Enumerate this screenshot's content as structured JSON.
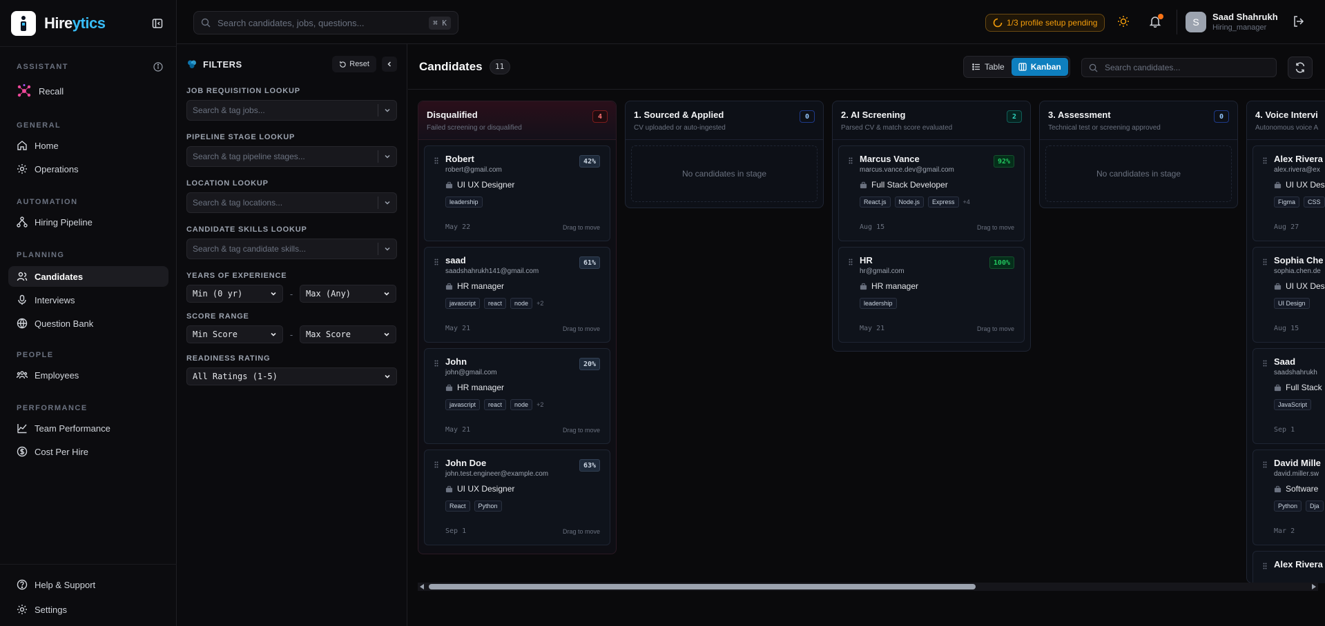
{
  "brand": {
    "name_a": "Hire",
    "name_b": "ytics"
  },
  "sidebar": {
    "sections": [
      {
        "label": "ASSISTANT",
        "items": [
          {
            "label": "Recall",
            "icon": "recall-molecule-icon"
          }
        ]
      },
      {
        "label": "GENERAL",
        "items": [
          {
            "label": "Home",
            "icon": "home-icon"
          },
          {
            "label": "Operations",
            "icon": "gear-icon"
          }
        ]
      },
      {
        "label": "AUTOMATION",
        "items": [
          {
            "label": "Hiring Pipeline",
            "icon": "pipeline-icon"
          }
        ]
      },
      {
        "label": "PLANNING",
        "items": [
          {
            "label": "Candidates",
            "icon": "users-icon"
          },
          {
            "label": "Interviews",
            "icon": "mic-icon"
          },
          {
            "label": "Question Bank",
            "icon": "globe-icon"
          }
        ]
      },
      {
        "label": "PEOPLE",
        "items": [
          {
            "label": "Employees",
            "icon": "team-icon"
          }
        ]
      },
      {
        "label": "PERFORMANCE",
        "items": [
          {
            "label": "Team Performance",
            "icon": "chart-line-icon"
          },
          {
            "label": "Cost Per Hire",
            "icon": "dollar-icon"
          }
        ]
      }
    ],
    "footer": [
      {
        "label": "Help & Support",
        "icon": "help-icon"
      },
      {
        "label": "Settings",
        "icon": "gear-icon"
      }
    ]
  },
  "topbar": {
    "search_placeholder": "Search candidates, jobs, questions...",
    "shortcut": "⌘ K",
    "setup_pill": "1/3 profile setup pending",
    "user_initial": "S",
    "user_name": "Saad Shahrukh",
    "user_role": "Hiring_manager"
  },
  "filters": {
    "title": "FILTERS",
    "reset": "Reset",
    "job_label": "JOB REQUISITION LOOKUP",
    "job_placeholder": "Search & tag jobs...",
    "stage_label": "PIPELINE STAGE LOOKUP",
    "stage_placeholder": "Search & tag pipeline stages...",
    "location_label": "LOCATION LOOKUP",
    "location_placeholder": "Search & tag locations...",
    "skills_label": "CANDIDATE SKILLS LOOKUP",
    "skills_placeholder": "Search & tag candidate skills...",
    "experience_label": "YEARS OF EXPERIENCE",
    "experience_min": "Min (0 yr)",
    "experience_max": "Max (Any)",
    "score_label": "SCORE RANGE",
    "score_min": "Min Score",
    "score_max": "Max Score",
    "readiness_label": "READINESS RATING",
    "readiness_value": "All Ratings (1-5)",
    "range_sep": "-"
  },
  "main": {
    "title": "Candidates",
    "count": "11",
    "view_table": "Table",
    "view_kanban": "Kanban",
    "search_placeholder": "Search candidates..."
  },
  "board": {
    "drag_hint": "Drag to move",
    "empty_text": "No candidates in stage",
    "columns": [
      {
        "title": "Disqualified",
        "subtitle": "Failed screening or disqualified",
        "count": "4",
        "cards": [
          {
            "name": "Robert",
            "email": "robert@gmail.com",
            "role": "UI UX Designer",
            "tags": [
              "leadership"
            ],
            "more": "",
            "date": "May 22",
            "score": "42%"
          },
          {
            "name": "saad",
            "email": "saadshahrukh141@gmail.com",
            "role": "HR manager",
            "tags": [
              "javascript",
              "react",
              "node"
            ],
            "more": "+2",
            "date": "May 21",
            "score": "61%"
          },
          {
            "name": "John",
            "email": "john@gmail.com",
            "role": "HR manager",
            "tags": [
              "javascript",
              "react",
              "node"
            ],
            "more": "+2",
            "date": "May 21",
            "score": "20%"
          },
          {
            "name": "John Doe",
            "email": "john.test.engineer@example.com",
            "role": "UI UX Designer",
            "tags": [
              "React",
              "Python"
            ],
            "more": "",
            "date": "Sep 1",
            "score": "63%"
          }
        ]
      },
      {
        "title": "1. Sourced & Applied",
        "subtitle": "CV uploaded or auto-ingested",
        "count": "0",
        "cards": []
      },
      {
        "title": "2. AI Screening",
        "subtitle": "Parsed CV & match score evaluated",
        "count": "2",
        "cards": [
          {
            "name": "Marcus Vance",
            "email": "marcus.vance.dev@gmail.com",
            "role": "Full Stack Developer",
            "tags": [
              "React.js",
              "Node.js",
              "Express"
            ],
            "more": "+4",
            "date": "Aug 15",
            "score": "92%"
          },
          {
            "name": "HR",
            "email": "hr@gmail.com",
            "role": "HR manager",
            "tags": [
              "leadership"
            ],
            "more": "",
            "date": "May 21",
            "score": "100%"
          }
        ]
      },
      {
        "title": "3. Assessment",
        "subtitle": "Technical test or screening approved",
        "count": "0",
        "cards": []
      },
      {
        "title": "4. Voice Intervi",
        "subtitle": "Autonomous voice A",
        "count": "",
        "cards": [
          {
            "name": "Alex Rivera",
            "email": "alex.rivera@ex",
            "role": "UI UX Des",
            "tags": [
              "Figma",
              "CSS"
            ],
            "more": "",
            "date": "Aug 27",
            "score": ""
          },
          {
            "name": "Sophia Che",
            "email": "sophia.chen.de",
            "role": "UI UX Des",
            "tags": [
              "UI Design"
            ],
            "more": "",
            "date": "Aug 15",
            "score": ""
          },
          {
            "name": "Saad",
            "email": "saadshahrukh",
            "role": "Full Stack",
            "tags": [
              "JavaScript"
            ],
            "more": "",
            "date": "Sep 1",
            "score": ""
          },
          {
            "name": "David Mille",
            "email": "david.miller.sw",
            "role": "Software",
            "tags": [
              "Python",
              "Dja"
            ],
            "more": "",
            "date": "Mar 2",
            "score": ""
          },
          {
            "name": "Alex Rivera",
            "email": "",
            "role": "",
            "tags": [],
            "more": "",
            "date": "",
            "score": ""
          }
        ]
      }
    ]
  },
  "colors": {
    "accent": "#0e7fbf",
    "brand_blue": "#38bdf8",
    "warning": "#f59e0b",
    "score_green": "#22c55e"
  }
}
